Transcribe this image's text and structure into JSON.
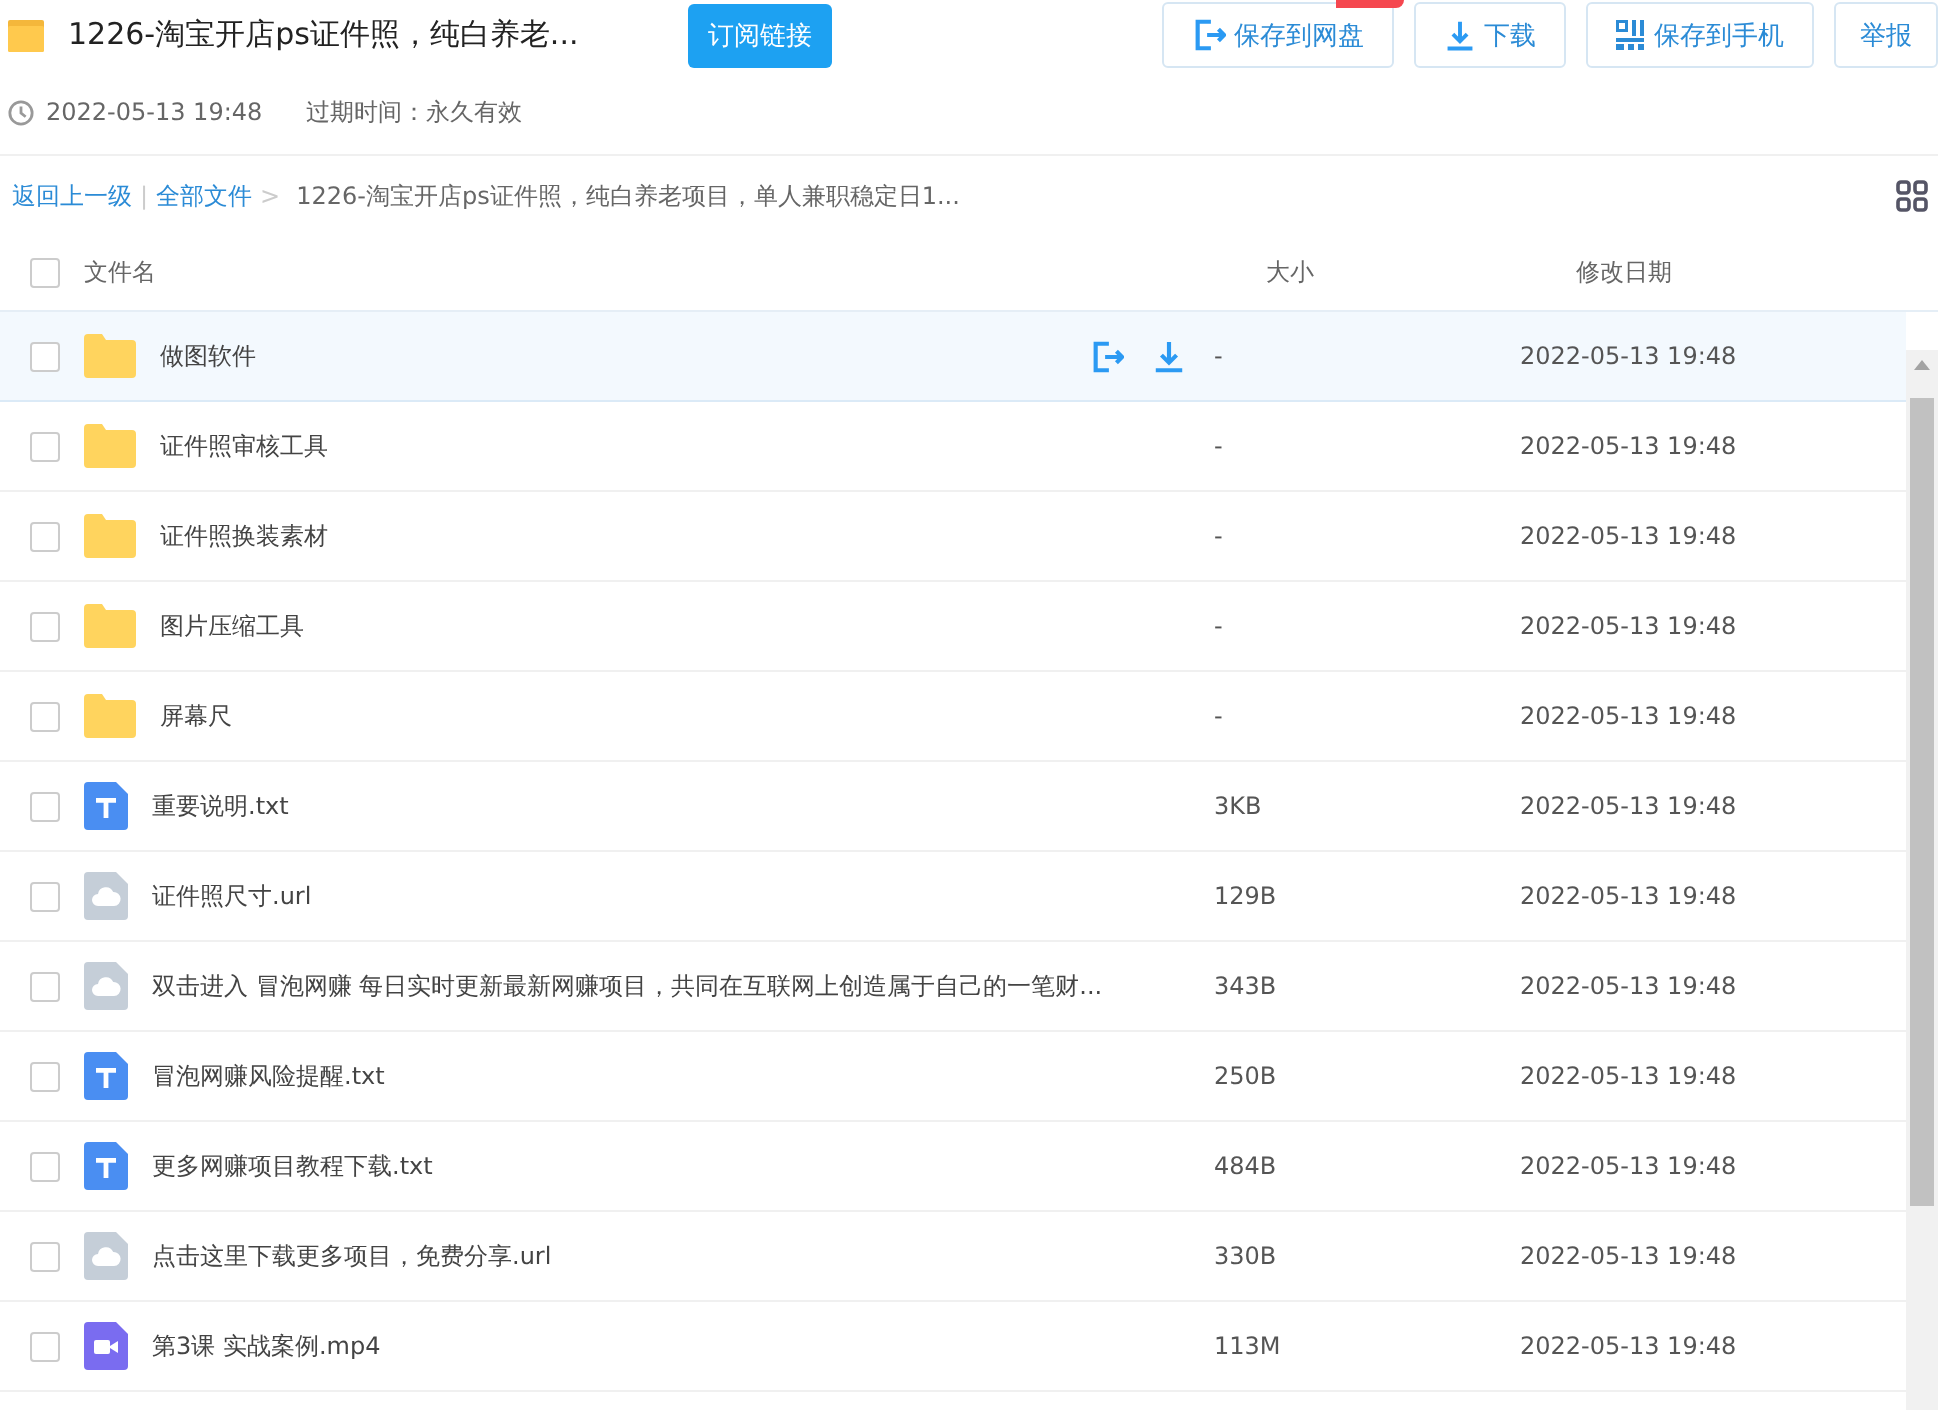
{
  "header": {
    "title": "1226-淘宝开店ps证件照，纯白养老...",
    "subscribe_button": "订阅链接",
    "actions": [
      {
        "kind": "save",
        "label": "保存到网盘",
        "badge": true
      },
      {
        "kind": "download",
        "label": "下载",
        "badge": false
      },
      {
        "kind": "phone",
        "label": "保存到手机",
        "badge": false
      },
      {
        "kind": "report",
        "label": "举报",
        "badge": false
      }
    ]
  },
  "meta": {
    "created": "2022-05-13 19:48",
    "expiry": "过期时间：永久有效"
  },
  "breadcrumb": {
    "back": "返回上一级",
    "separator": "|",
    "root": "全部文件",
    "arrow": ">",
    "current": "1226-淘宝开店ps证件照，纯白养老项目，单人兼职稳定日1..."
  },
  "table": {
    "columns": [
      "文件名",
      "大小",
      "修改日期"
    ],
    "select_all": false,
    "rows": [
      {
        "kind": "folder",
        "name": "做图软件",
        "size": "-",
        "date": "2022-05-13 19:48",
        "checked": false,
        "hovered": true
      },
      {
        "kind": "folder",
        "name": "证件照审核工具",
        "size": "-",
        "date": "2022-05-13 19:48",
        "checked": false,
        "hovered": false
      },
      {
        "kind": "folder",
        "name": "证件照换装素材",
        "size": "-",
        "date": "2022-05-13 19:48",
        "checked": false,
        "hovered": false
      },
      {
        "kind": "folder",
        "name": "图片压缩工具",
        "size": "-",
        "date": "2022-05-13 19:48",
        "checked": false,
        "hovered": false
      },
      {
        "kind": "folder",
        "name": "屏幕尺",
        "size": "-",
        "date": "2022-05-13 19:48",
        "checked": false,
        "hovered": false
      },
      {
        "kind": "text",
        "name": "重要说明.txt",
        "size": "3KB",
        "date": "2022-05-13 19:48",
        "checked": false,
        "hovered": false
      },
      {
        "kind": "link",
        "name": "证件照尺寸.url",
        "size": "129B",
        "date": "2022-05-13 19:48",
        "checked": false,
        "hovered": false
      },
      {
        "kind": "link",
        "name": "双击进入 冒泡网赚 每日实时更新最新网赚项目，共同在互联网上创造属于自己的一笔财...",
        "size": "343B",
        "date": "2022-05-13 19:48",
        "checked": false,
        "hovered": false
      },
      {
        "kind": "text",
        "name": "冒泡网赚风险提醒.txt",
        "size": "250B",
        "date": "2022-05-13 19:48",
        "checked": false,
        "hovered": false
      },
      {
        "kind": "text",
        "name": "更多网赚项目教程下载.txt",
        "size": "484B",
        "date": "2022-05-13 19:48",
        "checked": false,
        "hovered": false
      },
      {
        "kind": "link",
        "name": "点击这里下载更多项目，免费分享.url",
        "size": "330B",
        "date": "2022-05-13 19:48",
        "checked": false,
        "hovered": false
      },
      {
        "kind": "video",
        "name": "第3课 实战案例.mp4",
        "size": "113M",
        "date": "2022-05-13 19:48",
        "checked": false,
        "hovered": false
      }
    ]
  }
}
